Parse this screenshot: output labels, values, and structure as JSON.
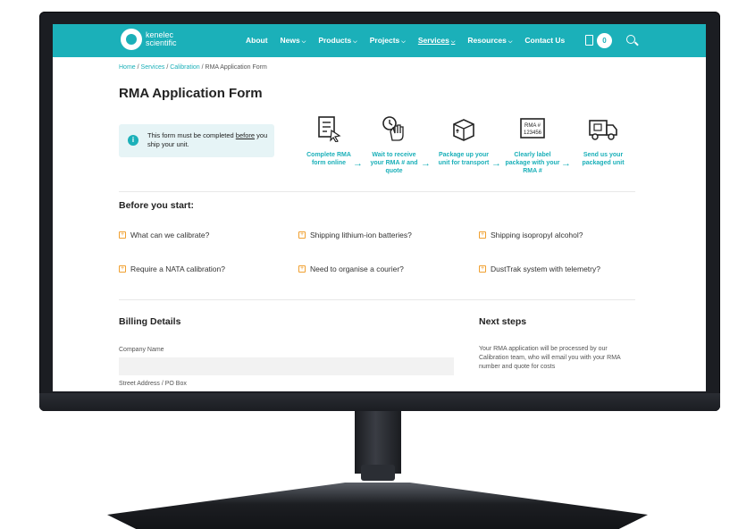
{
  "header": {
    "logo_line1": "kenelec",
    "logo_line2": "scientific",
    "nav": [
      {
        "label": "About",
        "dropdown": false,
        "active": false
      },
      {
        "label": "News",
        "dropdown": true,
        "active": false
      },
      {
        "label": "Products",
        "dropdown": true,
        "active": false
      },
      {
        "label": "Projects",
        "dropdown": true,
        "active": false
      },
      {
        "label": "Services",
        "dropdown": true,
        "active": true
      },
      {
        "label": "Resources",
        "dropdown": true,
        "active": false
      },
      {
        "label": "Contact Us",
        "dropdown": false,
        "active": false
      }
    ],
    "cart_count": "0",
    "accent": "#1bb0b9"
  },
  "breadcrumb": {
    "home": "Home",
    "services": "Services",
    "calibration": "Calibration",
    "current": "RMA Application Form"
  },
  "page_title": "RMA Application Form",
  "notice": {
    "text_before": "This form must be completed ",
    "text_underlined": "before",
    "text_after": " you ship your unit."
  },
  "steps": [
    {
      "label": "Complete RMA form online",
      "icon": "form-pointer-icon"
    },
    {
      "label": "Wait to receive your RMA # and quote",
      "icon": "clock-hand-icon"
    },
    {
      "label": "Package up your unit for transport",
      "icon": "box-icon"
    },
    {
      "label": "Clearly label package with your RMA #",
      "icon": "label-icon",
      "label_text": "RMA # 123456"
    },
    {
      "label": "Send us your packaged unit",
      "icon": "truck-icon"
    }
  ],
  "before_start": {
    "title": "Before you start:",
    "items": [
      "What can we calibrate?",
      "Shipping lithium-ion batteries?",
      "Shipping isopropyl alcohol?",
      "Require a NATA calibration?",
      "Need to organise a courier?",
      "DustTrak system with telemetry?"
    ]
  },
  "billing": {
    "title": "Billing Details",
    "company_label": "Company Name",
    "company_value": "",
    "street_label": "Street Address / PO Box"
  },
  "next_steps": {
    "title": "Next steps",
    "text": "Your RMA application will be processed by our Calibration team, who will email you with your RMA number and quote for costs"
  }
}
